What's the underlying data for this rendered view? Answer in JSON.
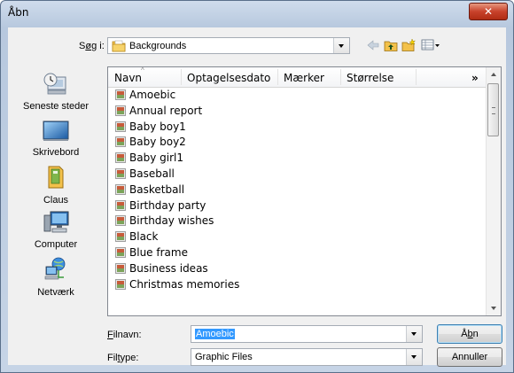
{
  "window": {
    "title": "Åbn",
    "close_glyph": "✕"
  },
  "toolbar": {
    "look_in_label_pre": "S",
    "look_in_label_ul": "ø",
    "look_in_label_post": "g i:",
    "look_in_value": "Backgrounds",
    "icons": [
      "back-arrow-icon",
      "up-folder-icon",
      "new-folder-icon",
      "views-menu-icon"
    ]
  },
  "places": [
    {
      "label": "Seneste steder",
      "icon": "recent-places-icon"
    },
    {
      "label": "Skrivebord",
      "icon": "desktop-icon"
    },
    {
      "label": "Claus",
      "icon": "user-folder-icon"
    },
    {
      "label": "Computer",
      "icon": "computer-icon"
    },
    {
      "label": "Netværk",
      "icon": "network-icon"
    }
  ],
  "list": {
    "columns": [
      "Navn",
      "Optagelsesdato",
      "Mærker",
      "Størrelse",
      "»"
    ],
    "files": [
      "Amoebic",
      "Annual report",
      "Baby boy1",
      "Baby boy2",
      "Baby girl1",
      "Baseball",
      "Basketball",
      "Birthday party",
      "Birthday wishes",
      "Black",
      "Blue frame",
      "Business ideas",
      "Christmas memories"
    ]
  },
  "bottom": {
    "filename_label_ul": "F",
    "filename_label_post": "ilnavn:",
    "filename_value": "Amoebic",
    "filetype_label_pre": "Fil",
    "filetype_label_ul": "t",
    "filetype_label_post": "ype:",
    "filetype_value": "Graphic Files",
    "open_pre": "Å",
    "open_ul": "b",
    "open_post": "n",
    "cancel": "Annuller"
  },
  "colors": {
    "selection": "#3399ff",
    "close_button": "#c8422b",
    "title_bar": "#b7c8de"
  }
}
